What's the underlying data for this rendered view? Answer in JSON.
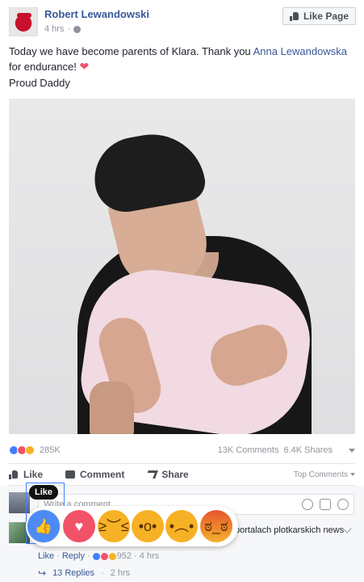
{
  "post": {
    "author": "Robert Lewandowski",
    "time": "4 hrs",
    "like_page_label": "Like Page",
    "text_before_link": "Today we have become parents of Klara. Thank you ",
    "link_text": "Anna Lewandowska",
    "text_after_link": " for endurance!",
    "text_line2": "Proud Daddy"
  },
  "stats": {
    "reaction_count": "285K",
    "comments": "13K Comments",
    "shares": "6.4K Shares"
  },
  "actions": {
    "like": "Like",
    "comment": "Comment",
    "share": "Share",
    "top_comments": "Top Comments"
  },
  "composer": {
    "placeholder": "Write a comment..."
  },
  "comment": {
    "visible_text": "portalach plotkarskich news",
    "like_label": "Like",
    "reply_label": "Reply",
    "reaction_count": "952",
    "time": "4 hrs",
    "replies": "13 Replies",
    "replies_time": "2 hrs"
  },
  "tooltip": {
    "label": "Like"
  },
  "reactions": [
    "like-icon",
    "love-icon",
    "haha-icon",
    "wow-icon",
    "sad-icon",
    "angry-icon"
  ]
}
